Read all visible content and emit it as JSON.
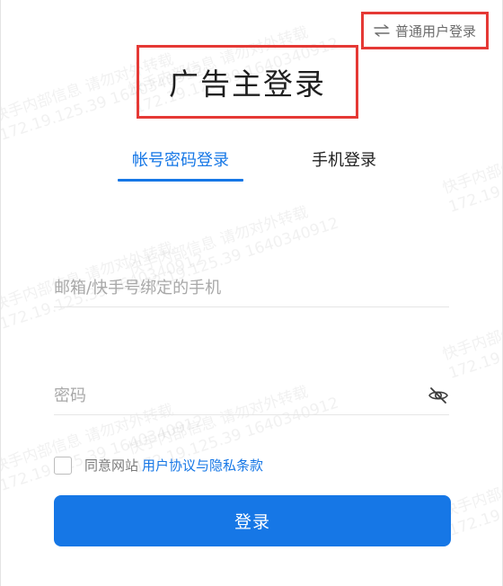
{
  "header": {
    "switch_label": "普通用户登录",
    "switch_icon": "swap-arrows-icon",
    "title": "广告主登录"
  },
  "tabs": [
    {
      "label": "帐号密码登录",
      "active": true
    },
    {
      "label": "手机登录",
      "active": false
    }
  ],
  "form": {
    "account_placeholder": "邮箱/快手号绑定的手机",
    "account_value": "",
    "password_placeholder": "密码",
    "password_value": "",
    "password_toggle_icon": "eye-off-icon",
    "agreement_checked": false,
    "agreement_prefix": "同意网站",
    "agreement_link": "用户协议与隐私条款",
    "submit_label": "登录"
  },
  "watermark": {
    "line1": "快手内部信息 请勿对外转载",
    "line2": "172.19.125.39 1640340912"
  },
  "colors": {
    "accent": "#1677e6",
    "highlight_border": "#e53935",
    "muted_text": "#a8a8a8"
  }
}
